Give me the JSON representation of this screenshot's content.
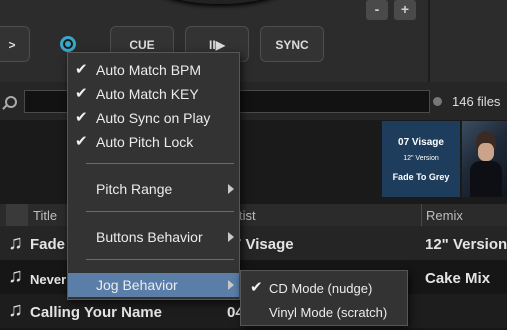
{
  "deck": {
    "cue_label": "CUE",
    "play_label": "II▶",
    "sync_label": "SYNC",
    "minus_label": "-",
    "plus_label": "+",
    "left_arrow": ">"
  },
  "search": {
    "placeholder": "",
    "file_count": "146 files"
  },
  "artwork": {
    "album1": {
      "artist": "07 Visage",
      "version": "12\" Version",
      "title": "Fade To Grey",
      "color": "#1e3d5c"
    }
  },
  "table": {
    "columns": [
      "Title",
      "Artist",
      "Remix"
    ],
    "rows": [
      {
        "title": "Fade",
        "artist": "7 Visage",
        "remix": "12\" Version"
      },
      {
        "title": "Never",
        "artist": "",
        "remix": "Cake Mix"
      },
      {
        "title": "Calling Your Name",
        "artist": "04",
        "remix": ""
      }
    ]
  },
  "menu": {
    "items": [
      {
        "label": "Auto Match BPM",
        "checked": true
      },
      {
        "label": "Auto Match KEY",
        "checked": true
      },
      {
        "label": "Auto Sync on Play",
        "checked": true
      },
      {
        "label": "Auto Pitch Lock",
        "checked": true
      },
      {
        "label": "Pitch Range",
        "submenu": true
      },
      {
        "label": "Buttons Behavior",
        "submenu": true
      },
      {
        "label": "Jog Behavior",
        "submenu": true,
        "highlighted": true
      }
    ],
    "check_glyph": "✔",
    "highlight_color": "#5a7ea8"
  },
  "submenu": {
    "items": [
      {
        "label": "CD Mode (nudge)",
        "checked": true
      },
      {
        "label": "Vinyl Mode (scratch)",
        "checked": false
      }
    ]
  },
  "accent_color": "#3aa7c9"
}
